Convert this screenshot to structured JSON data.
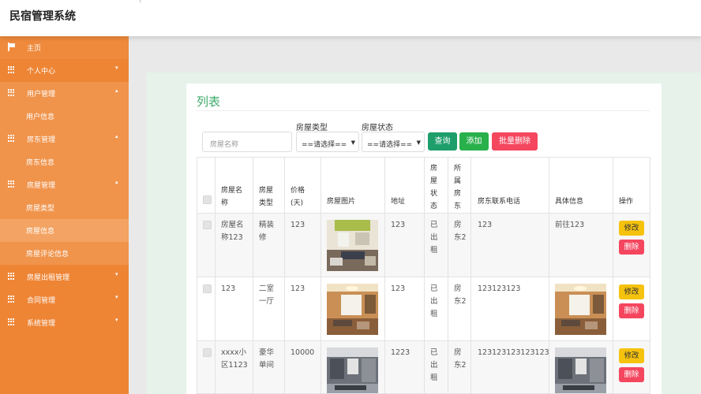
{
  "app": {
    "title": "民宿管理系统"
  },
  "sidebar": {
    "items": [
      {
        "label": "主页",
        "icon": "flag-icon"
      },
      {
        "label": "个人中心",
        "icon": "grid-icon",
        "caret": "▾"
      },
      {
        "label": "用户管理",
        "icon": "grid-icon",
        "caret": "▴"
      },
      {
        "label": "用户信息"
      },
      {
        "label": "房东管理",
        "icon": "grid-icon",
        "caret": "▴"
      },
      {
        "label": "房东信息"
      },
      {
        "label": "房屋管理",
        "icon": "grid-icon",
        "caret": "▴"
      },
      {
        "label": "房屋类型"
      },
      {
        "label": "房屋信息"
      },
      {
        "label": "房屋评论信息"
      },
      {
        "label": "房屋出租管理",
        "icon": "grid-icon",
        "caret": "▾"
      },
      {
        "label": "合同管理",
        "icon": "grid-icon",
        "caret": "▾"
      },
      {
        "label": "系统管理",
        "icon": "grid-icon",
        "caret": "▾"
      }
    ]
  },
  "page": {
    "title": "列表"
  },
  "filters": {
    "name_placeholder": "房屋名称",
    "type_label": "房屋类型",
    "type_value": "==请选择==",
    "status_label": "房屋状态",
    "status_value": "==请选择=="
  },
  "buttons": {
    "query": "查询",
    "add": "添加",
    "batch_delete": "批量删除",
    "edit": "修改",
    "delete": "删除"
  },
  "colors": {
    "sidebar": "#ee8535",
    "accent_green": "#3daa6b",
    "query_btn": "#1d9e6b",
    "add_btn": "#28b04b",
    "delete_btn": "#f5465f",
    "edit_btn": "#f5c20e"
  },
  "table": {
    "headers": {
      "name": "房屋名\n称",
      "type": "房屋\n类型",
      "price": "价格\n(天)",
      "image": "房屋图片",
      "address": "地址",
      "status": "房\n屋\n状\n态",
      "owner": "所\n属\n房\n东",
      "phone": "房东联系电话",
      "detail": "具体信息",
      "action": "操作"
    },
    "rows": [
      {
        "name": "房屋名\n称123",
        "type": "精装\n修",
        "price": "123",
        "address": "123",
        "status": "已\n出\n租",
        "owner": "房\n东2",
        "phone": "123",
        "detail": "前往123"
      },
      {
        "name": "123",
        "type": "二室\n一厅",
        "price": "123",
        "address": "123",
        "status": "已\n出\n租",
        "owner": "房\n东2",
        "phone": "123123123",
        "detail": ""
      },
      {
        "name": "xxxx小\n区1123",
        "type": "豪华\n单间",
        "price": "10000",
        "address": "1223",
        "status": "已\n出\n租",
        "owner": "房\n东2",
        "phone": "123123123123123",
        "detail": ""
      }
    ]
  }
}
